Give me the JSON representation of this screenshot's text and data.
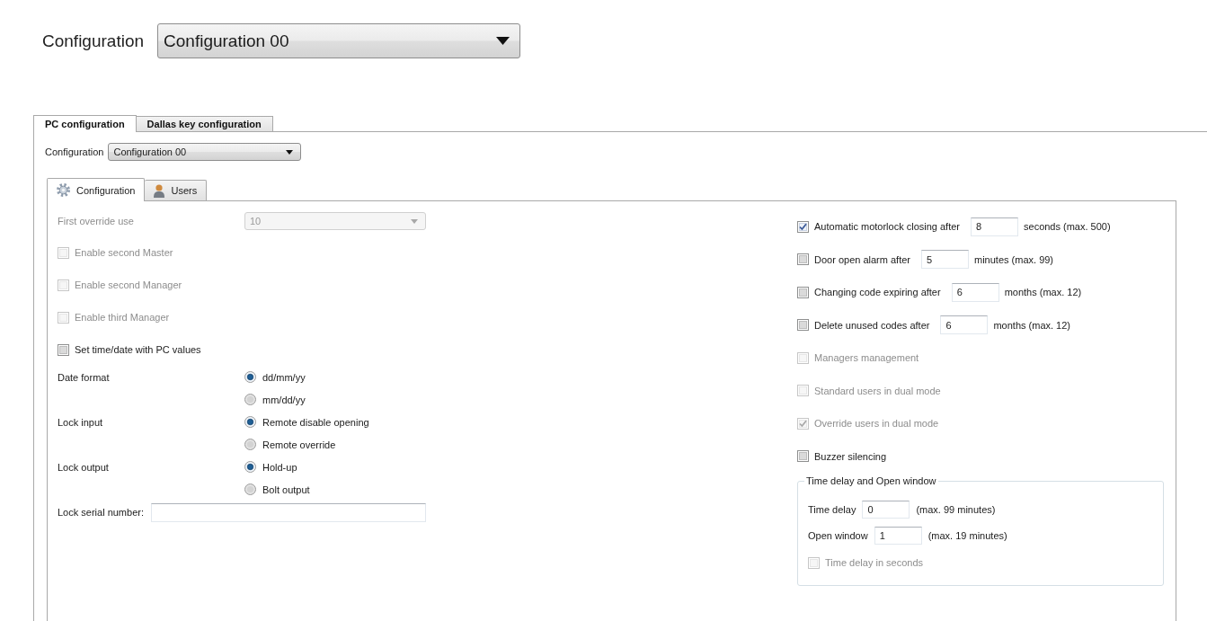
{
  "header": {
    "label": "Configuration",
    "dropdown": {
      "value": "Configuration 00"
    }
  },
  "tabs": [
    {
      "label": "PC configuration",
      "selected": true
    },
    {
      "label": "Dallas key configuration",
      "selected": false
    }
  ],
  "configuration": {
    "label": "Configuration",
    "dropdown": {
      "value": "Configuration 00"
    }
  },
  "subtabs": [
    {
      "label": "Configuration",
      "selected": true
    },
    {
      "label": "Users",
      "selected": false
    }
  ],
  "general": {
    "first_override_use": {
      "label": "First override use",
      "value": "10",
      "disabled": true
    },
    "checkboxes": [
      {
        "label": "Enable second Master",
        "checked": false,
        "disabled": true
      },
      {
        "label": "Enable second Manager",
        "checked": false,
        "disabled": true
      },
      {
        "label": "Enable third Manager",
        "checked": false,
        "disabled": true
      },
      {
        "label": "Set time/date with PC values",
        "checked": false,
        "disabled": false
      }
    ],
    "radio_groups": [
      {
        "label": "Date format",
        "options": [
          {
            "label": "dd/mm/yy",
            "selected": true
          },
          {
            "label": "mm/dd/yy",
            "selected": false
          }
        ]
      },
      {
        "label": "Lock input",
        "options": [
          {
            "label": "Remote disable opening",
            "selected": true
          },
          {
            "label": "Remote override",
            "selected": false
          }
        ]
      },
      {
        "label": "Lock output",
        "options": [
          {
            "label": "Hold-up",
            "selected": true
          },
          {
            "label": "Bolt output",
            "selected": false
          }
        ]
      }
    ],
    "serial_number": {
      "label": "Lock serial number:"
    }
  },
  "timers": {
    "timed_options": [
      {
        "label": "Automatic motorlock closing after",
        "checked": true,
        "value": "8",
        "unit": "seconds (max. 500)"
      },
      {
        "label": "Door open alarm after",
        "checked": false,
        "value": "5",
        "unit": "minutes (max. 99)"
      },
      {
        "label": "Changing code expiring after",
        "checked": false,
        "value": "6",
        "unit": "months (max. 12)"
      },
      {
        "label": "Delete unused codes after",
        "checked": false,
        "value": "6",
        "unit": "months (max. 12)"
      }
    ],
    "checkboxes": [
      {
        "label": "Managers management",
        "checked": false,
        "disabled": true
      },
      {
        "label": "Standard users in dual mode",
        "checked": false,
        "disabled": true
      },
      {
        "label": "Override users in dual mode",
        "checked": true,
        "disabled": true
      },
      {
        "label": "Buzzer silencing",
        "checked": false,
        "disabled": false
      }
    ],
    "time_delay_group": {
      "title": "Time delay and Open window",
      "fields": [
        {
          "label": "Time delay",
          "value": "0",
          "note": "(max. 99 minutes)"
        },
        {
          "label": "Open window",
          "value": "1",
          "note": "(max. 19 minutes)"
        }
      ],
      "checkbox": {
        "label": "Time delay in seconds",
        "checked": false,
        "disabled": true
      }
    }
  }
}
